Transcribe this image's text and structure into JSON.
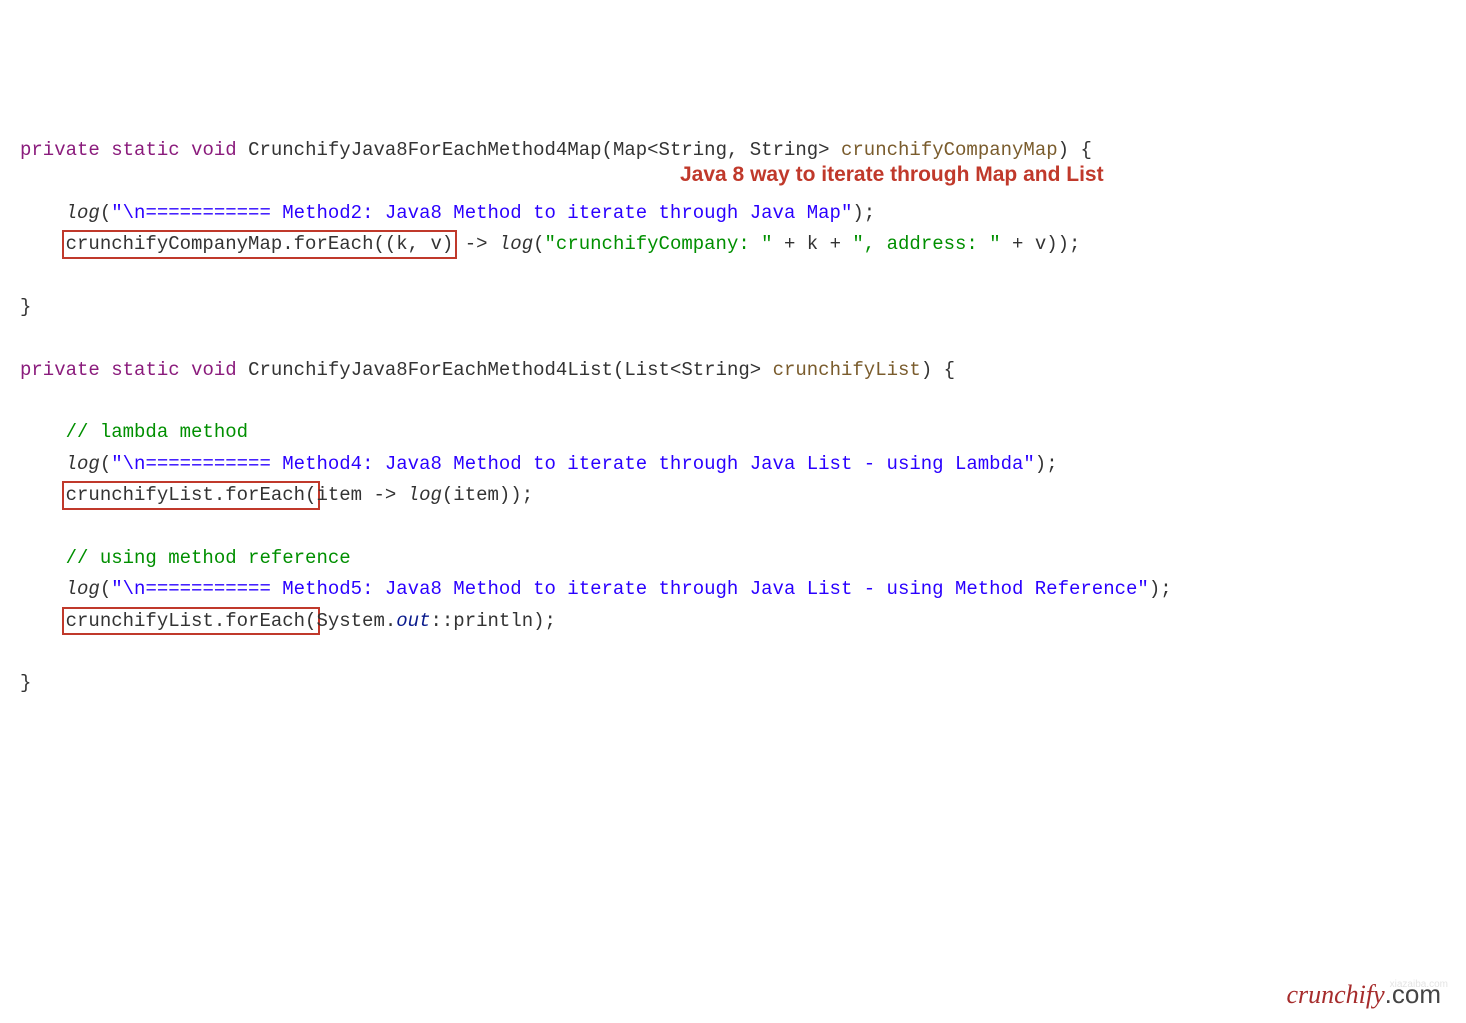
{
  "m1": {
    "kw_private": "private",
    "kw_static": "static",
    "kw_void": "void",
    "name": "CrunchifyJava8ForEachMethod4Map",
    "ptype": "Map<String, String>",
    "pname": "crunchifyCompanyMap",
    "log_fn": "log",
    "log_arg": "\"\\n=========== Method2: Java8 Method to iterate through Java Map\"",
    "hl_target": "crunchifyCompanyMap",
    "dot": ".",
    "foreach": "forEach(",
    "hl_lambda": "(k, v)",
    "arrow": " -> ",
    "log2_fn": "log",
    "pieces": {
      "s1": "\"crunchifyCompany: \"",
      "p1": " + k + ",
      "s2": "\", address: \"",
      "p2": " + v));"
    },
    "close": "}"
  },
  "annotation": "Java 8 way to iterate through Map and List",
  "m2": {
    "kw_private": "private",
    "kw_static": "static",
    "kw_void": "void",
    "name": "CrunchifyJava8ForEachMethod4List",
    "ptype": "List<String>",
    "pname": "crunchifyList",
    "comment1": "// lambda method",
    "log1_fn": "log",
    "log1_arg": "\"\\n=========== Method4: Java8 Method to iterate through Java List - using Lambda\"",
    "hl1": "crunchifyList.forEach(",
    "lambda1": "item -> ",
    "log_item_fn": "log",
    "log_item_arg": "(item));",
    "comment2": "// using method reference",
    "log2_fn": "log",
    "log2_arg": "\"\\n=========== Method5: Java8 Method to iterate through Java List - using Method Reference\"",
    "hl2": "crunchifyList.forEach(",
    "sysout_sys": "System.",
    "sysout_out": "out",
    "sysout_rest": "::println);",
    "close": "}"
  },
  "watermark": {
    "brand": "crunchify",
    "ext": ".com"
  },
  "faint": "xiazaiba.com"
}
